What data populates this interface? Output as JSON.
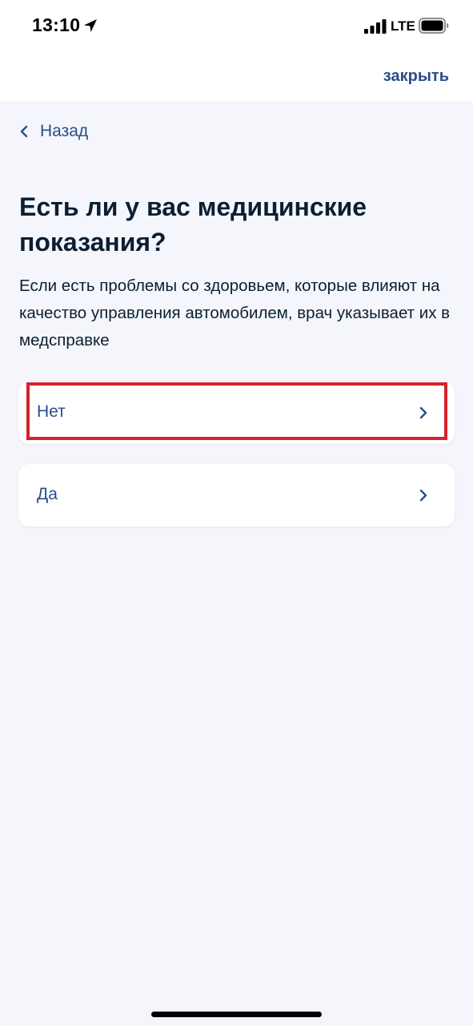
{
  "status_bar": {
    "time": "13:10",
    "network": "LTE"
  },
  "header": {
    "close_label": "закрыть"
  },
  "nav": {
    "back_label": "Назад"
  },
  "main": {
    "question": "Есть ли у вас медицинские показания?",
    "hint": "Если есть проблемы со здоровьем, которые влияют на качество управления автомобилем, врач указывает их в медсправке",
    "options": [
      {
        "label": "Нет",
        "highlighted": true
      },
      {
        "label": "Да",
        "highlighted": false
      }
    ]
  },
  "colors": {
    "background": "#f5f6fb",
    "link": "#2a4d8f",
    "text": "#0b1f33",
    "highlight_frame": "#d7212c"
  },
  "icons": [
    "location-arrow-icon",
    "cellular-signal-icon",
    "battery-icon",
    "chevron-left-icon",
    "chevron-right-icon"
  ]
}
